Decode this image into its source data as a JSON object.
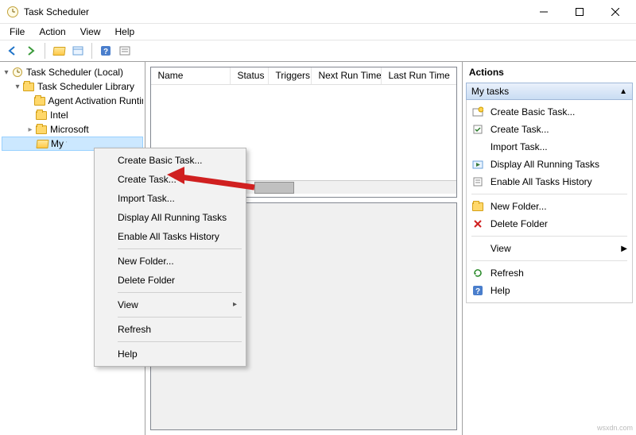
{
  "titlebar": {
    "title": "Task Scheduler"
  },
  "menubar": {
    "file": "File",
    "action": "Action",
    "view": "View",
    "help": "Help"
  },
  "tree": {
    "root": "Task Scheduler (Local)",
    "library": "Task Scheduler Library",
    "nodes": {
      "agent": "Agent Activation Runtime",
      "intel": "Intel",
      "microsoft": "Microsoft",
      "mytasks": "My tasks"
    }
  },
  "columns": {
    "name": "Name",
    "status": "Status",
    "triggers": "Triggers",
    "nextrun": "Next Run Time",
    "lastrun": "Last Run Time"
  },
  "contextmenu": {
    "create_basic": "Create Basic Task...",
    "create_task": "Create Task...",
    "import": "Import Task...",
    "display_running": "Display All Running Tasks",
    "enable_history": "Enable All Tasks History",
    "new_folder": "New Folder...",
    "delete_folder": "Delete Folder",
    "view": "View",
    "refresh": "Refresh",
    "help": "Help"
  },
  "actions": {
    "title": "Actions",
    "header": "My tasks",
    "items": {
      "create_basic": "Create Basic Task...",
      "create_task": "Create Task...",
      "import": "Import Task...",
      "display_running": "Display All Running Tasks",
      "enable_history": "Enable All Tasks History",
      "new_folder": "New Folder...",
      "delete_folder": "Delete Folder",
      "view": "View",
      "refresh": "Refresh",
      "help": "Help"
    }
  },
  "watermark": "wsxdn.com"
}
